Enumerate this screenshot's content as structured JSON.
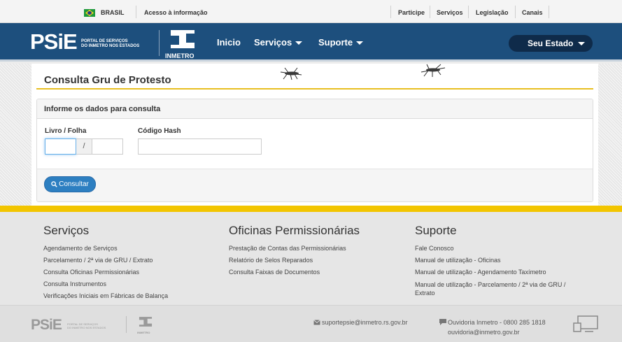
{
  "govbar": {
    "country": "BRASIL",
    "access_info": "Acesso à informação",
    "links": [
      "Participe",
      "Serviços",
      "Legislação",
      "Canais"
    ]
  },
  "header": {
    "logo": "PSiE",
    "logo_sub_1": "PORTAL DE SERVIÇOS",
    "logo_sub_2": "DO INMETRO NOS ESTADOS",
    "inmetro": "INMETRO",
    "nav": {
      "inicio": "Inicio",
      "servicos": "Serviços",
      "suporte": "Suporte"
    },
    "estado": "Seu Estado"
  },
  "page": {
    "title": "Consulta Gru de Protesto",
    "panel_heading": "Informe os dados para consulta",
    "livro_label": "Livro / Folha",
    "separator": "/",
    "hash_label": "Código Hash",
    "livro_value": "",
    "folha_value": "",
    "hash_value": "",
    "submit": "Consultar"
  },
  "footer": {
    "servicos": {
      "title": "Serviços",
      "links": [
        "Agendamento de Serviços",
        "Parcelamento / 2ª via de GRU / Extrato",
        "Consulta Oficinas Permissionárias",
        "Consulta Instrumentos",
        "Verificações Iniciais em Fábricas de Balança"
      ]
    },
    "oficinas": {
      "title": "Oficinas Permissionárias",
      "links": [
        "Prestação de Contas das Permissionárias",
        "Relatório de Selos Reparados",
        "Consulta Faixas de Documentos"
      ]
    },
    "suporte": {
      "title": "Suporte",
      "links": [
        "Fale Conosco",
        "Manual de utilização - Oficinas",
        "Manual de utilização - Agendamento Taxímetro",
        "Manual de utilização - Parcelamento / 2ª via de GRU /",
        "Extrato"
      ]
    },
    "bottom": {
      "logo": "PSiE",
      "logo_sub_1": "PORTAL DE SERVIÇOS",
      "logo_sub_2": "DO INMETRO NOS ESTADOS",
      "inmetro": "INMETRO",
      "email": "suportepsie@inmetro.rs.gov.br",
      "ouvidoria": "Ouvidoria Inmetro - 0800 285 1818",
      "ouvidoria_email": "ouvidoria@inmetro.gov.br"
    }
  },
  "colors": {
    "header_bg": "#1d4f7d",
    "accent_yellow": "#f2c500",
    "button_blue": "#2d7fc1",
    "estado_bg": "#0f2b4a"
  },
  "icons": [
    "brazil-flag-icon",
    "chevron-down-icon",
    "search-icon",
    "envelope-icon",
    "chat-icon",
    "devices-icon",
    "mosquito-icon"
  ]
}
